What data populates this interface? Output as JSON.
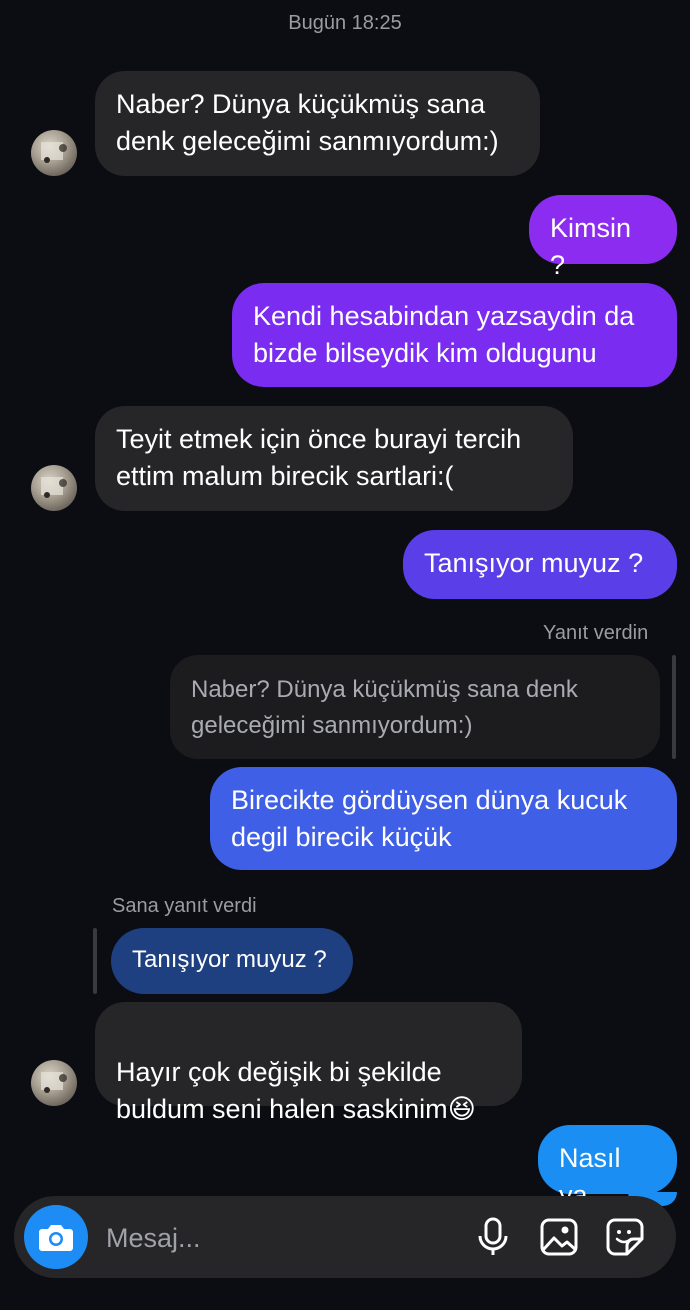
{
  "header": {
    "timestamp": "Bugün 18:25"
  },
  "messages": [
    {
      "from": "them",
      "text": "Naber?  Dünya küçükmüş sana\ndenk geleceğimi sanmıyordum:)"
    },
    {
      "from": "me",
      "text": "Kimsin ?"
    },
    {
      "from": "me",
      "text": "Kendi hesabindan yazsaydin da\nbizde bilseydik kim oldugunu"
    },
    {
      "from": "them",
      "text": "Teyit etmek için önce burayi tercih\nettim  malum birecik sartlari:("
    },
    {
      "from": "me",
      "text": "Tanışıyor muyuz  ?"
    },
    {
      "from": "me",
      "reply_label": "Yanıt verdin",
      "quoted": "Naber?  Dünya küçükmüş sana denk\ngeleceğimi sanmıyordum:)",
      "text": "Birecikte gördüysen dünya kucuk\ndegil birecik küçük"
    },
    {
      "from": "them",
      "reply_label": "Sana yanıt verdi",
      "quoted": "Tanışıyor muyuz  ?",
      "text": "Hayır  çok değişik bi şekilde\nbuldum seni halen saskinim"
    },
    {
      "from": "me",
      "text": "Nasıl ya"
    }
  ],
  "emoji": "😆",
  "composer": {
    "placeholder": "Mesaj...",
    "icons": [
      "camera-icon",
      "microphone-icon",
      "image-icon",
      "sticker-icon"
    ]
  },
  "colors": {
    "background": "#0b0d12",
    "incoming_bubble": "#262629",
    "outgoing_gradient_top": "#9b3ee0",
    "outgoing_gradient_bottom": "#1d8cf4",
    "accent": "#1d8cf4"
  }
}
